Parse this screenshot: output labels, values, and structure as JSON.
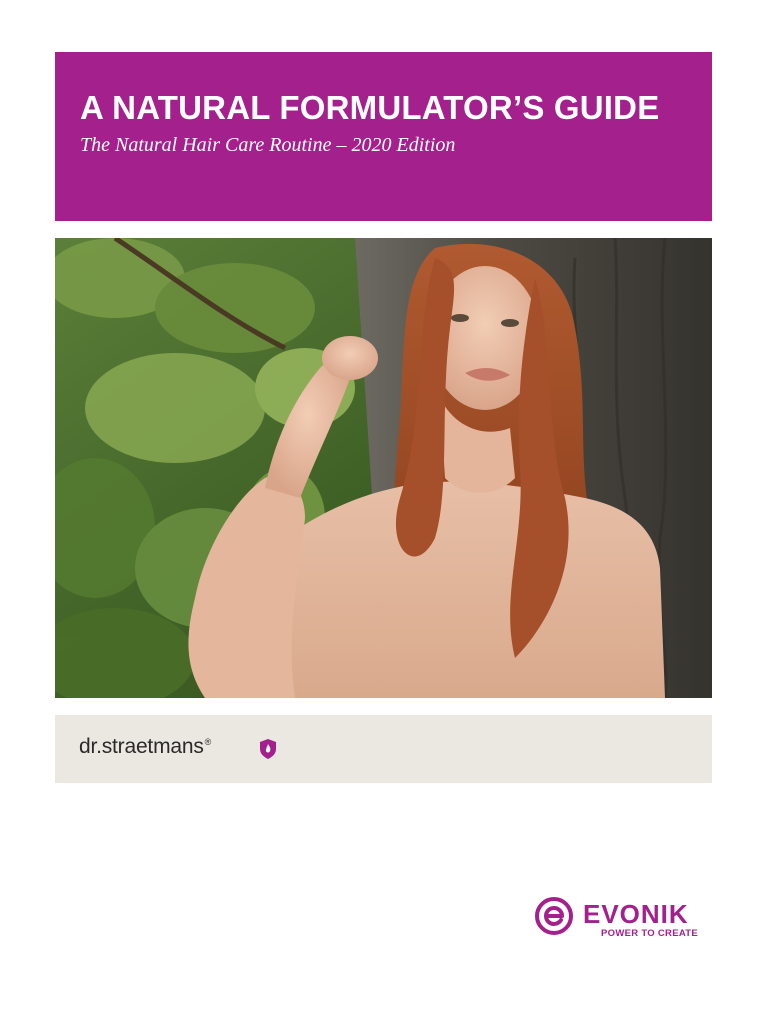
{
  "header": {
    "title": "A NATURAL FORMULATOR’S GUIDE",
    "subtitle": "The Natural Hair Care Routine – 2020 Edition"
  },
  "hero": {
    "subject": "woman-with-red-hair-by-tree"
  },
  "brand_bar": {
    "name": "dr.straetmans",
    "registered_mark": "®",
    "icon": "shield-flame-icon"
  },
  "footer_logo": {
    "name": "EVONIK",
    "tagline": "POWER TO CREATE",
    "icon": "evonik-e-icon"
  },
  "colors": {
    "brand_purple": "#a4208c",
    "brand_bar_bg": "#ebe8e2",
    "text_dark": "#2a2a2a"
  }
}
